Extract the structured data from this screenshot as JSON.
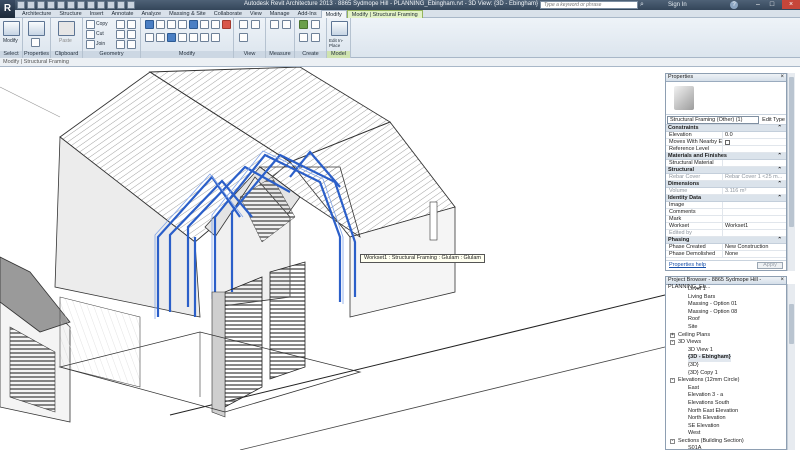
{
  "window": {
    "title": "Autodesk Revit Architecture 2013 · 8865 Sydmope Hill - PLANNING_Ebingham.rvt - 3D View: {3D - Ebingham}",
    "search_placeholder": "Type a keyword or phrase",
    "signin": "Sign In"
  },
  "tabs": [
    {
      "label": "Architecture"
    },
    {
      "label": "Structure"
    },
    {
      "label": "Insert"
    },
    {
      "label": "Annotate"
    },
    {
      "label": "Analyze"
    },
    {
      "label": "Massing & Site"
    },
    {
      "label": "Collaborate"
    },
    {
      "label": "View"
    },
    {
      "label": "Manage"
    },
    {
      "label": "Add-Ins"
    },
    {
      "label": "Modify"
    },
    {
      "label": "Modify | Structural Framing"
    }
  ],
  "ribbon": {
    "modify_label": "Modify",
    "copy_label": "Copy",
    "cut_label": "Cut",
    "join_label": "Join",
    "paste_label": "Paste",
    "edit_inplace_label": "Edit In-Place",
    "panels": [
      "Select",
      "Properties",
      "Clipboard",
      "Geometry",
      "Modify",
      "View",
      "Measure",
      "Create",
      "Model"
    ]
  },
  "options_bar": {
    "status": "Modify | Structural Framing"
  },
  "tooltip": "Workset1 : Structural Framing : Glulam : Glulam",
  "colors": {
    "selection": "#2b5fc9",
    "ribbon_context": "#cfe3b0"
  },
  "properties": {
    "title": "Properties",
    "type_name": "Structural Framing (Other) (1)",
    "edit_type": "Edit Type",
    "groups": [
      {
        "name": "Constraints",
        "rows": [
          {
            "name": "Elevation",
            "value": "0.0"
          },
          {
            "name": "Moves With Nearby El...",
            "value": ""
          },
          {
            "name": "Reference Level",
            "value": ""
          }
        ]
      },
      {
        "name": "Materials and Finishes",
        "rows": [
          {
            "name": "Structural Material",
            "value": ""
          }
        ]
      },
      {
        "name": "Structural",
        "rows": [
          {
            "name": "Rebar Cover",
            "value": "Rebar Cover 1 <25 m..."
          }
        ]
      },
      {
        "name": "Dimensions",
        "rows": [
          {
            "name": "Volume",
            "value": "3.116 m³"
          }
        ]
      },
      {
        "name": "Identity Data",
        "rows": [
          {
            "name": "Image",
            "value": ""
          },
          {
            "name": "Comments",
            "value": ""
          },
          {
            "name": "Mark",
            "value": ""
          },
          {
            "name": "Workset",
            "value": "Workset1"
          },
          {
            "name": "Edited by",
            "value": ""
          }
        ]
      },
      {
        "name": "Phasing",
        "rows": [
          {
            "name": "Phase Created",
            "value": "New Construction"
          },
          {
            "name": "Phase Demolished",
            "value": "None"
          }
        ]
      }
    ],
    "help_link": "Properties help",
    "apply": "Apply"
  },
  "browser": {
    "title": "Project Browser - 8865 Sydmope Hill - PLANNING_Eb...",
    "nodes": [
      {
        "label": "Level 1",
        "level": 3,
        "twisty": ""
      },
      {
        "label": "Living Bars",
        "level": 3,
        "twisty": ""
      },
      {
        "label": "Massing - Option 01",
        "level": 3,
        "twisty": ""
      },
      {
        "label": "Massing - Option 08",
        "level": 3,
        "twisty": ""
      },
      {
        "label": "Roof",
        "level": 3,
        "twisty": ""
      },
      {
        "label": "Site",
        "level": 3,
        "twisty": ""
      },
      {
        "label": "Ceiling Plans",
        "level": 2,
        "twisty": "+"
      },
      {
        "label": "3D Views",
        "level": 2,
        "twisty": "-"
      },
      {
        "label": "3D View 1",
        "level": 3,
        "twisty": ""
      },
      {
        "label": "{3D - Ebingham}",
        "level": 3,
        "twisty": "",
        "bold": true
      },
      {
        "label": "{3D}",
        "level": 3,
        "twisty": ""
      },
      {
        "label": "{3D} Copy 1",
        "level": 3,
        "twisty": ""
      },
      {
        "label": "Elevations (12mm Circle)",
        "level": 2,
        "twisty": "-"
      },
      {
        "label": "East",
        "level": 3,
        "twisty": ""
      },
      {
        "label": "Elevation 3 - a",
        "level": 3,
        "twisty": ""
      },
      {
        "label": "Elevations South",
        "level": 3,
        "twisty": ""
      },
      {
        "label": "North East Elevation",
        "level": 3,
        "twisty": ""
      },
      {
        "label": "North Elevation",
        "level": 3,
        "twisty": ""
      },
      {
        "label": "SE Elevation",
        "level": 3,
        "twisty": ""
      },
      {
        "label": "West",
        "level": 3,
        "twisty": ""
      },
      {
        "label": "Sections (Building Section)",
        "level": 2,
        "twisty": "-"
      },
      {
        "label": "S01A",
        "level": 3,
        "twisty": ""
      }
    ]
  }
}
